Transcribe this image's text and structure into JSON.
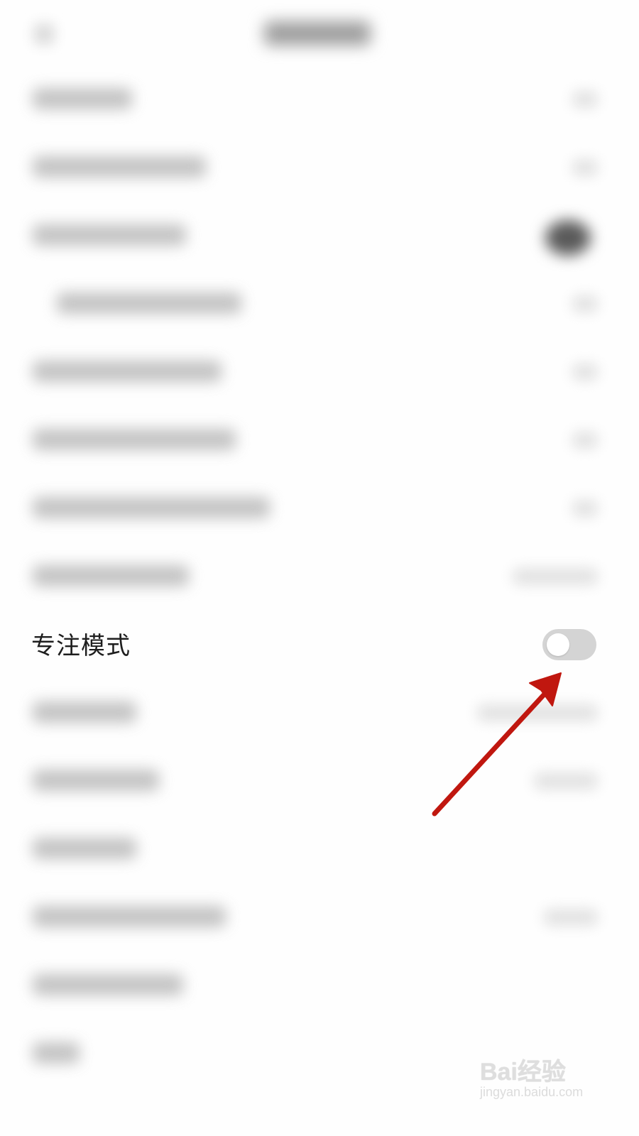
{
  "settings": {
    "focus_mode": {
      "label": "专注模式",
      "enabled": false
    }
  },
  "annotation": {
    "arrow_color": "#c0170f"
  },
  "watermark": {
    "brand": "Bai经验",
    "url": "jingyan.baidu.com"
  }
}
